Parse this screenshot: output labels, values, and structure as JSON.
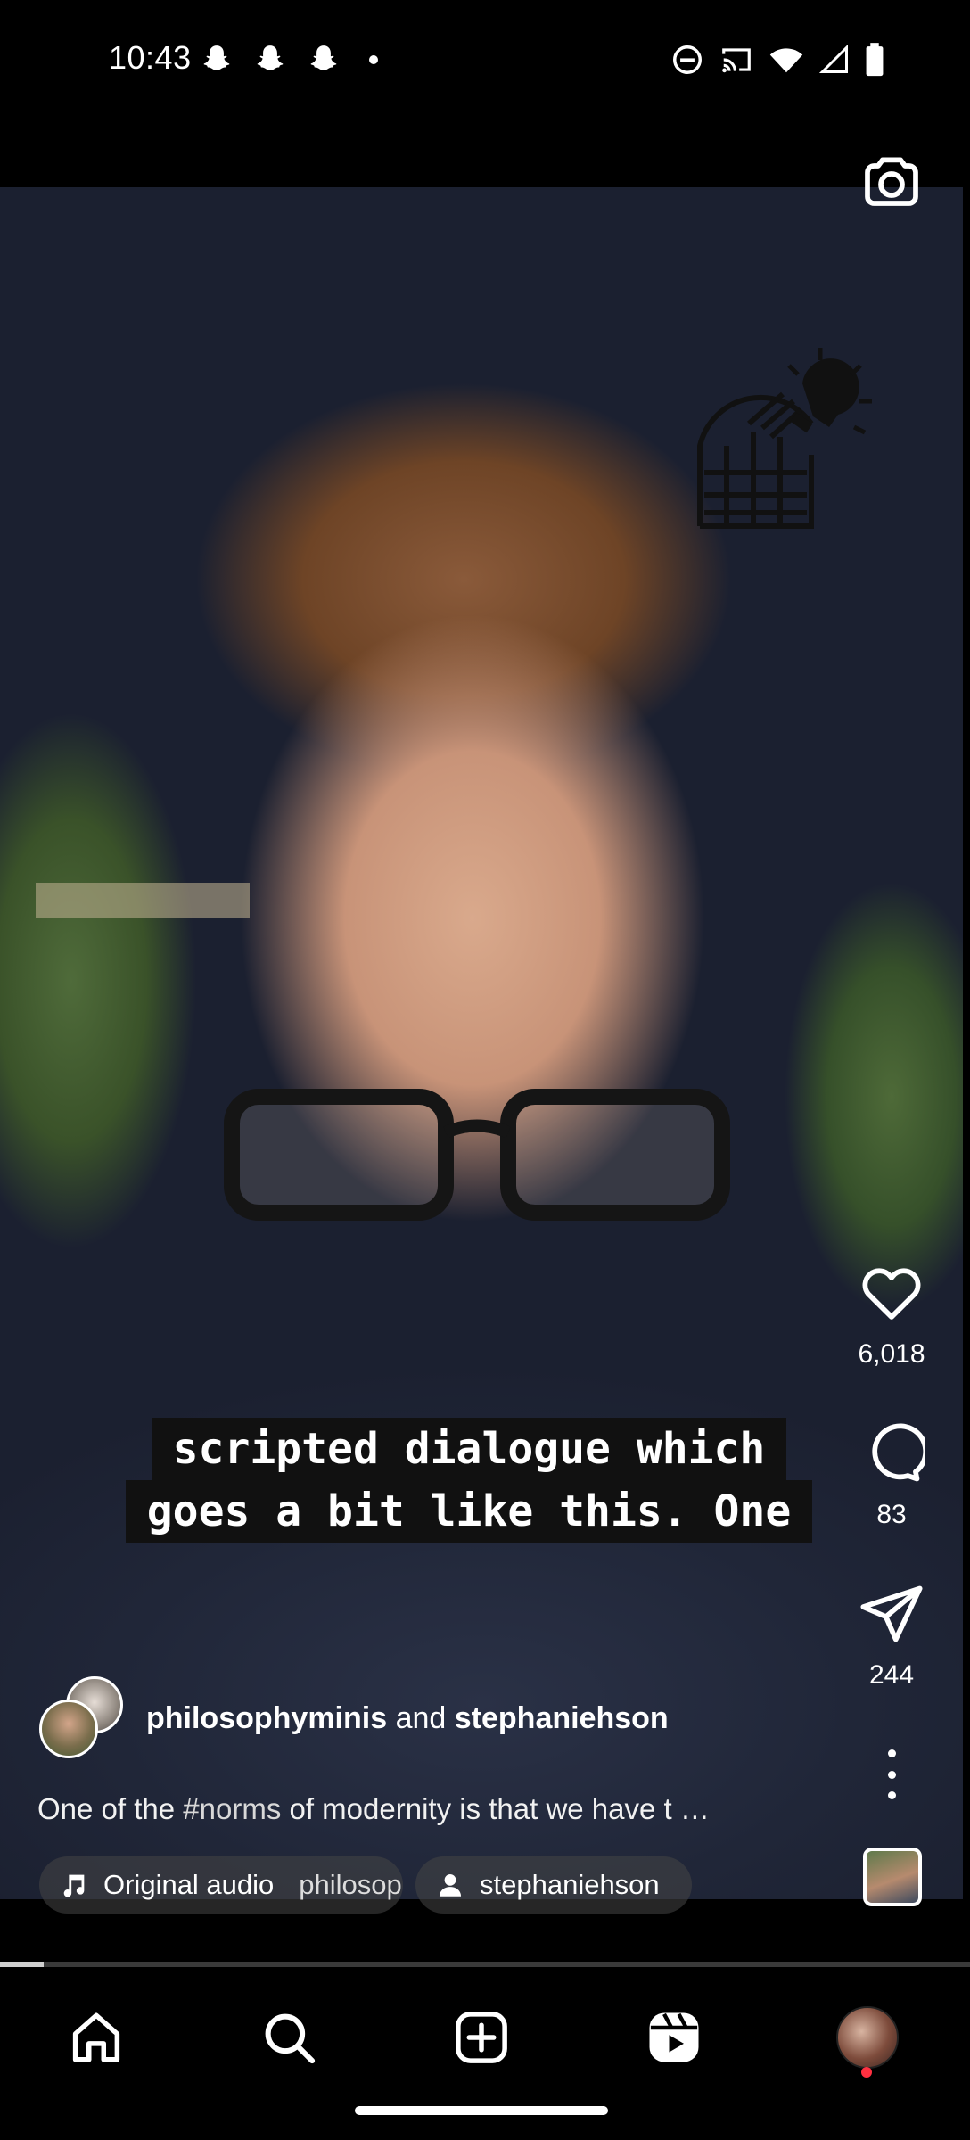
{
  "status_bar": {
    "time": "10:43",
    "left_icons": [
      "snapchat-icon",
      "snapchat-icon",
      "snapchat-icon",
      "dot-icon"
    ],
    "right_icons": [
      "do-not-disturb-icon",
      "cast-icon",
      "wifi-icon",
      "signal-icon",
      "battery-icon"
    ]
  },
  "video": {
    "caption_lines": [
      "scripted dialogue which",
      "goes a bit like this. One"
    ],
    "watermark_icon": "observatory-lightbulb-logo-icon",
    "progress": 0.045
  },
  "top_actions": {
    "camera_icon": "camera-icon"
  },
  "actions": {
    "likes": "6,018",
    "comments": "83",
    "shares": "244",
    "like_icon": "heart-icon",
    "comment_icon": "comment-bubble-icon",
    "share_icon": "paper-plane-icon",
    "more_icon": "more-vertical-icon"
  },
  "post": {
    "author_primary": "philosophyminis",
    "joiner": "and",
    "author_collab": "stephaniehson",
    "caption_before": "One of the ",
    "caption_hashtag": "#norms",
    "caption_after": " of modernity is that we have t …",
    "audio_label": "Original audio",
    "audio_source": "philosophyminis",
    "tagged_user": "stephaniehson"
  },
  "bottom_nav": {
    "items": [
      "home-icon",
      "search-icon",
      "create-icon",
      "reels-icon",
      "profile-avatar"
    ]
  },
  "colors": {
    "background": "#000000",
    "notification_dot": "#ff3040",
    "caption_bg": "#111111"
  }
}
